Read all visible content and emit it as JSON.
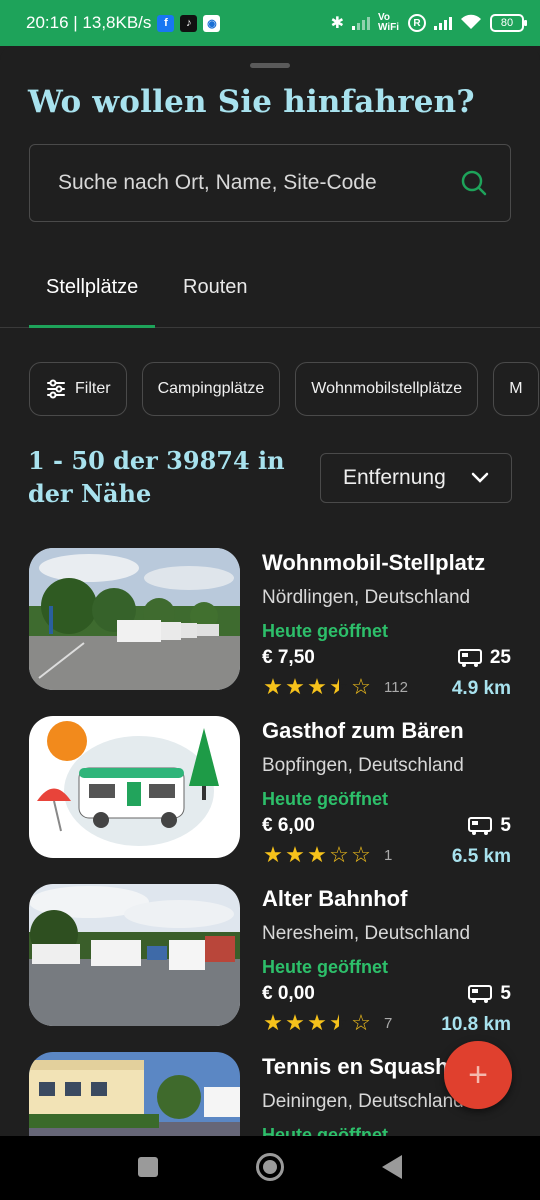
{
  "status_bar": {
    "time_speed": "20:16 | 13,8KB/s",
    "app_icons": [
      "facebook-icon",
      "tiktok-icon",
      "app-icon"
    ],
    "volte": "Vo WiFi",
    "roaming": "R",
    "battery": "80"
  },
  "header": {
    "title": "Wo wollen Sie hinfahren?"
  },
  "search": {
    "placeholder": "Suche nach Ort, Name, Site-Code"
  },
  "tabs": [
    {
      "label": "Stellplätze",
      "active": true
    },
    {
      "label": "Routen",
      "active": false
    }
  ],
  "chips": [
    {
      "label": "Filter"
    },
    {
      "label": "Campingplätze"
    },
    {
      "label": "Wohnmobilstellplätze"
    },
    {
      "label": "M"
    }
  ],
  "results": {
    "count_line1": "1 - 50 der 39874 in",
    "count_line2": "der Nähe",
    "sort_label": "Entfernung"
  },
  "listings": [
    {
      "name": "Wohnmobil-Stellplatz",
      "location": "Nördlingen, Deutschland",
      "status": "Heute geöffnet",
      "price": "€ 7,50",
      "spots": "25",
      "rating": 3.5,
      "review_count": "112",
      "distance": "4.9 km"
    },
    {
      "name": "Gasthof zum Bären",
      "location": "Bopfingen, Deutschland",
      "status": "Heute geöffnet",
      "price": "€ 6,00",
      "spots": "5",
      "rating": 3,
      "review_count": "1",
      "distance": "6.5 km"
    },
    {
      "name": "Alter Bahnhof",
      "location": "Neresheim, Deutschland",
      "status": "Heute geöffnet",
      "price": "€ 0,00",
      "spots": "5",
      "rating": 3.5,
      "review_count": "7",
      "distance": "10.8 km"
    },
    {
      "name": "Tennis en Squash",
      "location": "Deiningen, Deutschland",
      "status": "Heute geöffnet"
    }
  ],
  "colors": {
    "accent_green": "#1ea35a",
    "heading_cyan": "#a8e2ee",
    "fab_red": "#e0402e",
    "star": "#f6c21b"
  }
}
